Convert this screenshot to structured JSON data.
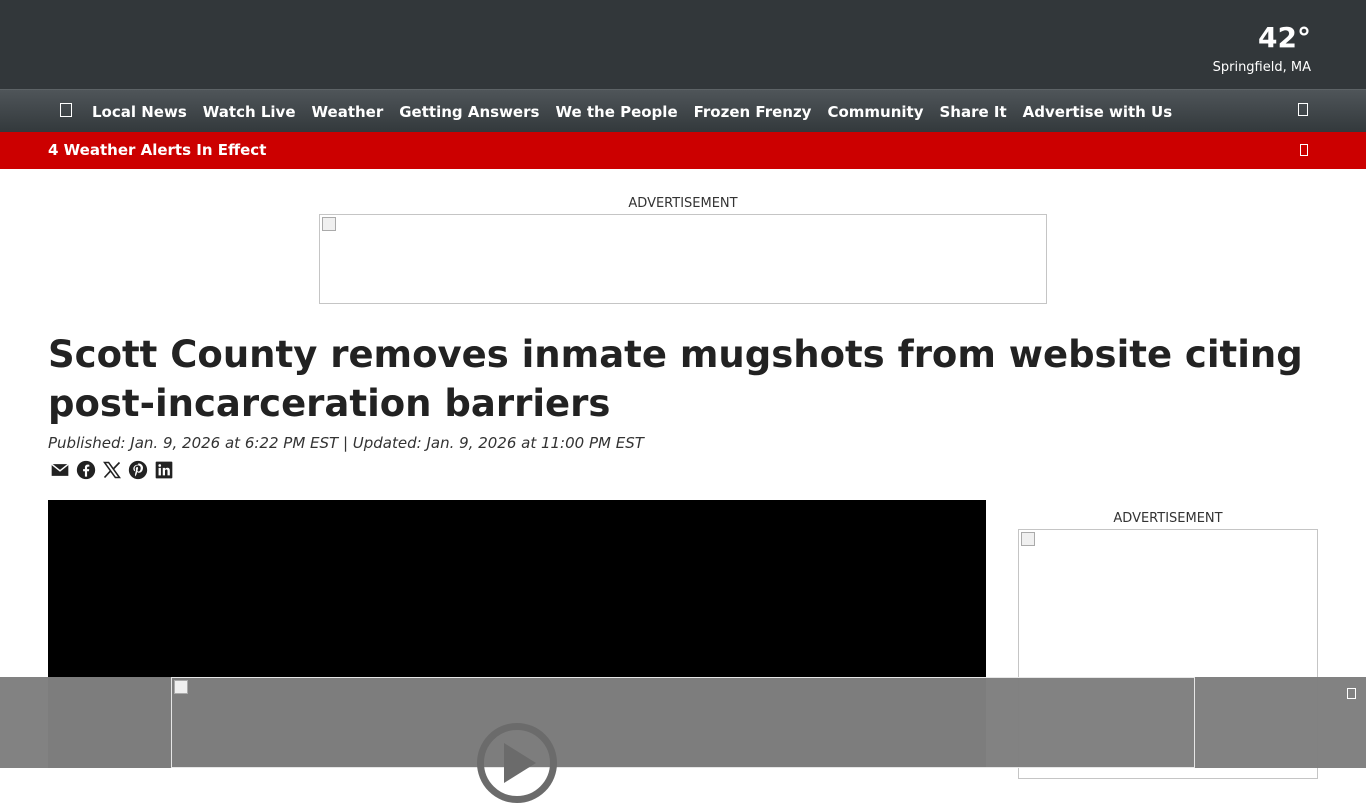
{
  "weather": {
    "temperature": "42°",
    "location": "Springfield, MA"
  },
  "nav": {
    "items": [
      "Local News",
      "Watch Live",
      "Weather",
      "Getting Answers",
      "We the People",
      "Frozen Frenzy",
      "Community",
      "Share It",
      "Advertise with Us"
    ]
  },
  "alert": {
    "text": "4 Weather Alerts In Effect"
  },
  "ads": {
    "top_label": "ADVERTISEMENT",
    "side_label": "ADVERTISEMENT"
  },
  "article": {
    "headline": "Scott County removes inmate mugshots from website citing post-incarceration barriers",
    "meta": "Published: Jan. 9, 2026 at 6:22 PM EST | Updated: Jan. 9, 2026 at 11:00 PM EST"
  },
  "share_icons": [
    "email-icon",
    "facebook-icon",
    "x-icon",
    "pinterest-icon",
    "linkedin-icon"
  ],
  "colors": {
    "topbar": "#32373a",
    "alert": "#cc0000",
    "video": "#000000"
  }
}
